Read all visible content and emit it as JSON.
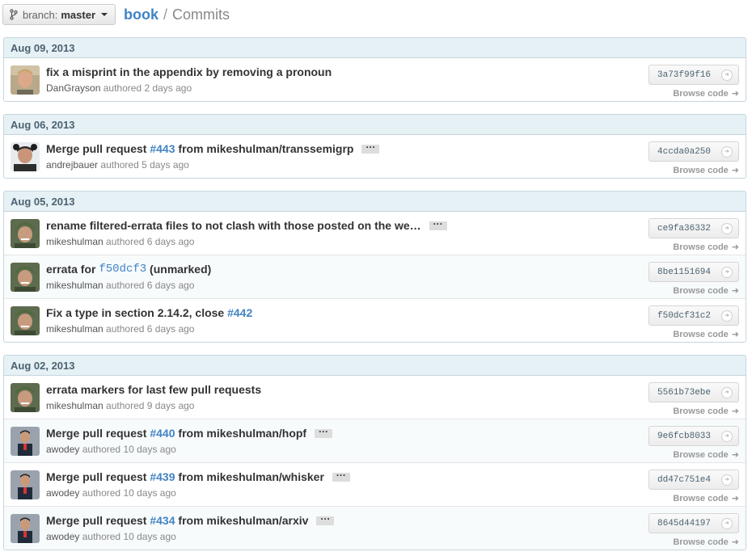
{
  "branch": {
    "label": "branch:",
    "value": "master"
  },
  "breadcrumb": {
    "repo": "book",
    "separator": "/",
    "page": "Commits"
  },
  "sha_button_arrow": "➜",
  "browse_label": "Browse code",
  "groups": [
    {
      "date": "Aug 09, 2013",
      "commits": [
        {
          "avatar": "dangrayson",
          "title": "fix a misprint in the appendix by removing a pronoun",
          "author": "DanGrayson",
          "verb": "authored",
          "time": "2 days ago",
          "sha": "3a73f99f16"
        }
      ]
    },
    {
      "date": "Aug 06, 2013",
      "commits": [
        {
          "avatar": "andrejbauer",
          "prefix": "Merge pull request ",
          "issue": "#443",
          "suffix": " from mikeshulman/transsemigrp",
          "ellipsis": "···",
          "author": "andrejbauer",
          "verb": "authored",
          "time": "5 days ago",
          "sha": "4ccda0a250"
        }
      ]
    },
    {
      "date": "Aug 05, 2013",
      "commits": [
        {
          "avatar": "mikeshulman",
          "title": "rename filtered-errata files to not clash with those posted on the we…",
          "ellipsis": "···",
          "author": "mikeshulman",
          "verb": "authored",
          "time": "6 days ago",
          "sha": "ce9fa36332"
        },
        {
          "avatar": "mikeshulman",
          "prefix": "errata for ",
          "sha_ref": "f50dcf3",
          "suffix": " (unmarked)",
          "author": "mikeshulman",
          "verb": "authored",
          "time": "6 days ago",
          "sha": "8be1151694"
        },
        {
          "avatar": "mikeshulman",
          "prefix": "Fix a type in section 2.14.2, close ",
          "issue": "#442",
          "author": "mikeshulman",
          "verb": "authored",
          "time": "6 days ago",
          "sha": "f50dcf31c2"
        }
      ]
    },
    {
      "date": "Aug 02, 2013",
      "commits": [
        {
          "avatar": "mikeshulman",
          "title": "errata markers for last few pull requests",
          "author": "mikeshulman",
          "verb": "authored",
          "time": "9 days ago",
          "sha": "5561b73ebe"
        },
        {
          "avatar": "awodey",
          "prefix": "Merge pull request ",
          "issue": "#440",
          "suffix": " from mikeshulman/hopf",
          "ellipsis": "···",
          "author": "awodey",
          "verb": "authored",
          "time": "10 days ago",
          "sha": "9e6fcb8033"
        },
        {
          "avatar": "awodey",
          "prefix": "Merge pull request ",
          "issue": "#439",
          "suffix": " from mikeshulman/whisker",
          "ellipsis": "···",
          "author": "awodey",
          "verb": "authored",
          "time": "10 days ago",
          "sha": "dd47c751e4"
        },
        {
          "avatar": "awodey",
          "prefix": "Merge pull request ",
          "issue": "#434",
          "suffix": " from mikeshulman/arxiv",
          "ellipsis": "···",
          "author": "awodey",
          "verb": "authored",
          "time": "10 days ago",
          "sha": "8645d44197"
        }
      ]
    }
  ]
}
